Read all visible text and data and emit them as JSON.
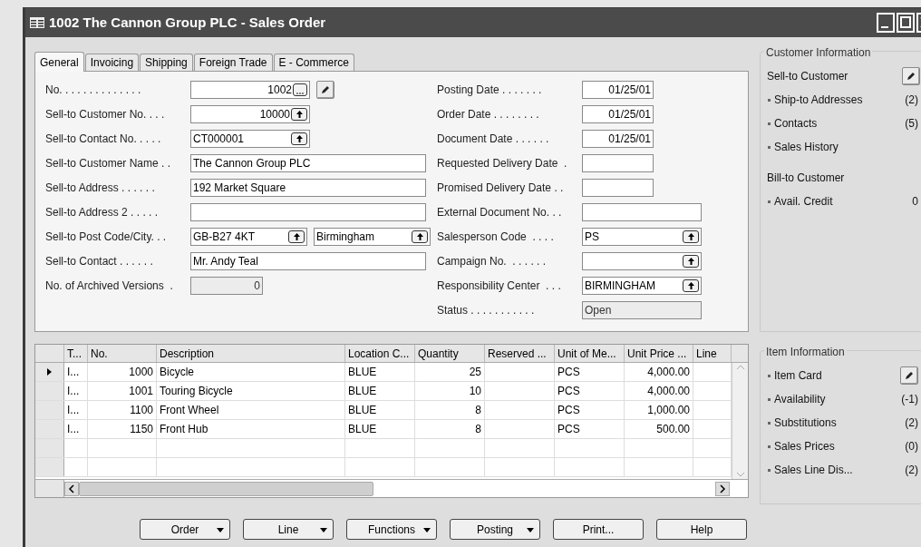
{
  "window": {
    "title": "1002 The Cannon Group PLC - Sales Order"
  },
  "tabs": [
    {
      "label": "General",
      "selected": true
    },
    {
      "label": "Invoicing",
      "selected": false
    },
    {
      "label": "Shipping",
      "selected": false
    },
    {
      "label": "Foreign Trade",
      "selected": false
    },
    {
      "label": "E - Commerce",
      "selected": false
    }
  ],
  "left_fields": [
    {
      "label": "No. . . . . . . . . . . . . .",
      "edit_button": true,
      "fields": [
        {
          "kind": "series",
          "value": "1002",
          "disabled": false
        }
      ]
    },
    {
      "label": "Sell-to Customer No. . . .",
      "edit_button": false,
      "fields": [
        {
          "kind": "number",
          "value": "10000",
          "disabled": false
        }
      ]
    },
    {
      "label": "Sell-to Contact No. . . . .",
      "edit_button": false,
      "fields": [
        {
          "kind": "code",
          "value": "CT000001",
          "disabled": false
        }
      ]
    },
    {
      "label": "Sell-to Customer Name . .",
      "edit_button": false,
      "fields": [
        {
          "kind": "text",
          "value": "The Cannon Group PLC",
          "disabled": false
        }
      ]
    },
    {
      "label": "Sell-to Address . . . . . .",
      "edit_button": false,
      "fields": [
        {
          "kind": "text",
          "value": "192 Market Square",
          "disabled": false
        }
      ]
    },
    {
      "label": "Sell-to Address 2 . . . . .",
      "edit_button": false,
      "fields": [
        {
          "kind": "text",
          "disabled": false
        }
      ]
    },
    {
      "label": "Sell-to Post Code/City. . .",
      "edit_button": false,
      "fields": [
        {
          "kind": "code",
          "value": "GB-B27 4KT",
          "disabled": false
        },
        {
          "kind": "code",
          "value": "Birmingham",
          "disabled": false
        }
      ]
    },
    {
      "label": "Sell-to Contact . . . . . .",
      "edit_button": false,
      "fields": [
        {
          "kind": "text",
          "value": "Mr. Andy Teal",
          "disabled": false
        }
      ]
    },
    {
      "label": "No. of Archived Versions  .",
      "edit_button": false,
      "fields": [
        {
          "kind": "count",
          "value": "0",
          "disabled": true
        }
      ]
    }
  ],
  "right_fields": [
    {
      "label": "Posting Date . . . . . . .",
      "fields": [
        {
          "kind": "date",
          "value": "01/25/01",
          "disabled": false
        }
      ]
    },
    {
      "label": "Order Date . . . . . . . .",
      "fields": [
        {
          "kind": "date",
          "value": "01/25/01",
          "disabled": false
        }
      ]
    },
    {
      "label": "Document Date . . . . . .",
      "fields": [
        {
          "kind": "date",
          "value": "01/25/01",
          "disabled": false
        }
      ]
    },
    {
      "label": "Requested Delivery Date  .",
      "fields": [
        {
          "kind": "date",
          "disabled": false
        }
      ]
    },
    {
      "label": "Promised Delivery Date . .",
      "fields": [
        {
          "kind": "date",
          "disabled": false
        }
      ]
    },
    {
      "label": "External Document No. . .",
      "fields": [
        {
          "kind": "text",
          "disabled": false
        }
      ]
    },
    {
      "label": "Salesperson Code  . . . .",
      "fields": [
        {
          "kind": "code",
          "value": "PS",
          "disabled": false
        }
      ]
    },
    {
      "label": "Campaign No.  . . . . . .",
      "fields": [
        {
          "kind": "code",
          "disabled": false
        }
      ]
    },
    {
      "label": "Responsibility Center  . . .",
      "fields": [
        {
          "kind": "code",
          "value": "BIRMINGHAM",
          "disabled": false
        }
      ]
    },
    {
      "label": "Status . . . . . . . . . . .",
      "fields": [
        {
          "kind": "text",
          "value": "Open",
          "disabled": true
        }
      ]
    }
  ],
  "lines": {
    "columns": [
      "T...",
      "No.",
      "Description",
      "Location C...",
      "Quantity",
      "Reserved ...",
      "Unit of Me...",
      "Unit Price ...",
      "Line"
    ],
    "rows": [
      {
        "selected": true,
        "cells": [
          "I...",
          "1000",
          "Bicycle",
          "BLUE",
          "25",
          null,
          "PCS",
          "4,000.00",
          null
        ]
      },
      {
        "selected": false,
        "cells": [
          "I...",
          "1001",
          "Touring Bicycle",
          "BLUE",
          "10",
          null,
          "PCS",
          "4,000.00",
          null
        ]
      },
      {
        "selected": false,
        "cells": [
          "I...",
          "1100",
          "Front Wheel",
          "BLUE",
          "8",
          null,
          "PCS",
          "1,000.00",
          null
        ]
      },
      {
        "selected": false,
        "cells": [
          "I...",
          "1150",
          "Front Hub",
          "BLUE",
          "8",
          null,
          "PCS",
          "500.00",
          null
        ]
      },
      {
        "selected": false
      },
      {
        "selected": false
      }
    ]
  },
  "customer_information": {
    "title": "Customer Information",
    "items": [
      {
        "kind": "heading",
        "label": "Sell-to Customer",
        "edit_button": true
      },
      {
        "kind": "link",
        "label": "Ship-to Addresses",
        "count": "(2)"
      },
      {
        "kind": "link",
        "label": "Contacts",
        "count": "(5)"
      },
      {
        "kind": "link",
        "label": "Sales History"
      },
      {
        "kind": "heading",
        "label": "Bill-to Customer",
        "edit_button": false
      },
      {
        "kind": "link",
        "label": "Avail. Credit",
        "count": "0"
      }
    ]
  },
  "item_information": {
    "title": "Item Information",
    "items": [
      {
        "kind": "link",
        "label": "Item Card",
        "edit_button": true
      },
      {
        "kind": "link",
        "label": "Availability",
        "count": "(-1)"
      },
      {
        "kind": "link",
        "label": "Substitutions",
        "count": "(2)"
      },
      {
        "kind": "link",
        "label": "Sales Prices",
        "count": "(0)"
      },
      {
        "kind": "link",
        "label": "Sales Line Dis...",
        "count": "(2)"
      }
    ]
  },
  "buttons": [
    {
      "label": "Order",
      "menu": true
    },
    {
      "label": "Line",
      "menu": true
    },
    {
      "label": "Functions",
      "menu": true
    },
    {
      "label": "Posting",
      "menu": true
    },
    {
      "label": "Print...",
      "menu": false
    },
    {
      "label": "Help",
      "menu": false
    }
  ]
}
